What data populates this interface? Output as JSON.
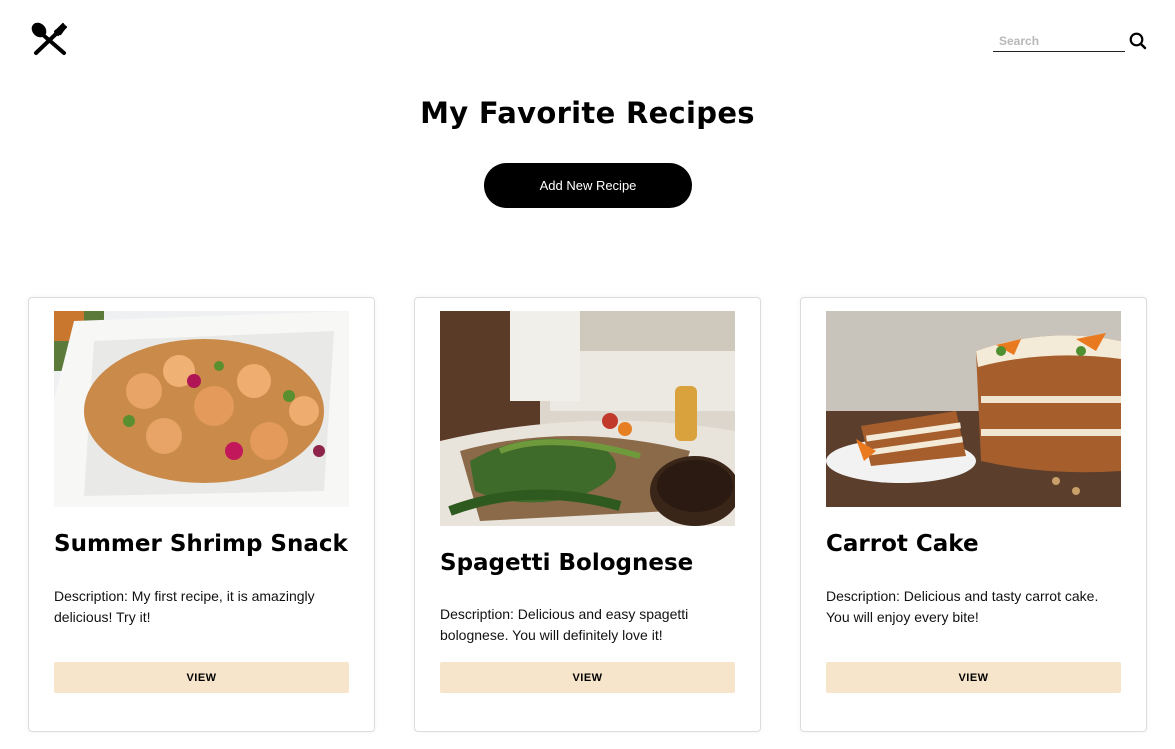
{
  "header": {
    "logo_icon": "fork-knife-crossed-icon",
    "search": {
      "placeholder": "Search",
      "value": "",
      "icon": "search-icon"
    }
  },
  "main": {
    "title": "My Favorite Recipes",
    "add_button_label": "Add New Recipe"
  },
  "recipes": [
    {
      "title": "Summer Shrimp Snack",
      "description": "Description: My first recipe, it is amazingly delicious! Try it!",
      "image": "grilled-shrimp-platter-photo",
      "button_label": "VIEW"
    },
    {
      "title": "Spagetti Bolognese",
      "description": "Description: Delicious and easy spagetti bolognese. You will definitely love it!",
      "image": "chef-chopping-vegetables-photo",
      "button_label": "VIEW"
    },
    {
      "title": "Carrot Cake",
      "description": "Description: Delicious and tasty carrot cake. You will enjoy every bite!",
      "image": "carrot-cake-slice-photo",
      "button_label": "VIEW"
    }
  ],
  "colors": {
    "view_button_bg": "#f6e5cb",
    "primary_button_bg": "#000000",
    "card_border": "#dcdcdc"
  }
}
